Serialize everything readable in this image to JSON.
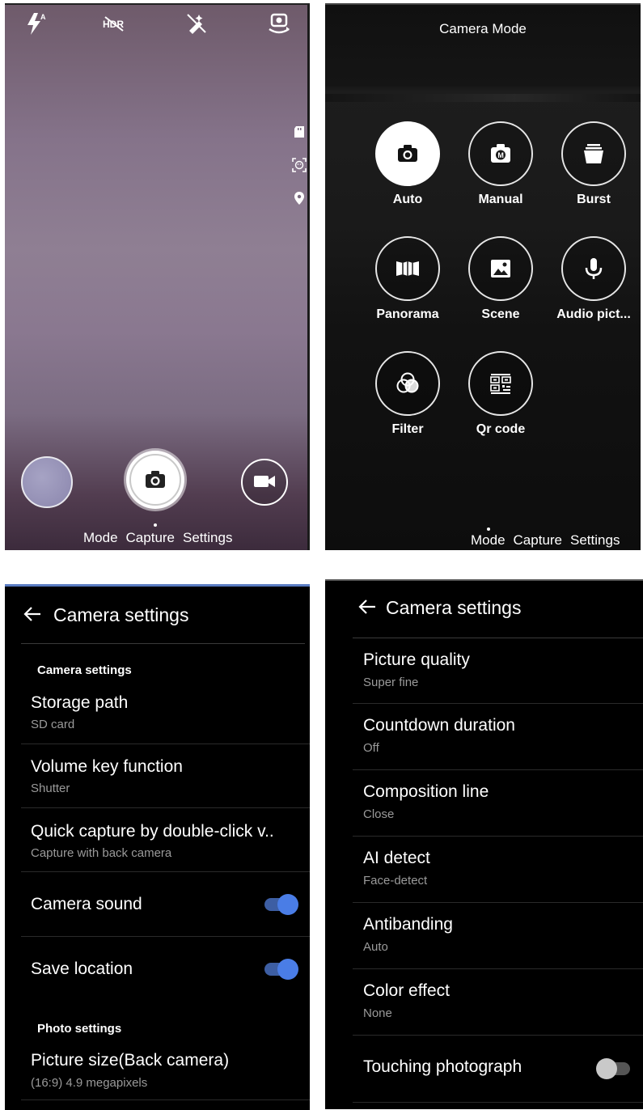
{
  "viewfinder": {
    "top_icons": [
      "flash-auto-icon",
      "hdr-off-icon",
      "beauty-off-icon",
      "switch-camera-icon"
    ],
    "side_icons": [
      "sd-card-icon",
      "face-detect-icon",
      "location-pin-icon"
    ],
    "bottom_nav": {
      "mode": "Mode",
      "capture": "Capture",
      "settings": "Settings"
    }
  },
  "camera_mode": {
    "title": "Camera Mode",
    "modes": [
      {
        "label": "Auto",
        "icon": "camera-icon",
        "active": true
      },
      {
        "label": "Manual",
        "icon": "manual-camera-icon",
        "active": false
      },
      {
        "label": "Burst",
        "icon": "burst-icon",
        "active": false
      },
      {
        "label": "Panorama",
        "icon": "panorama-icon",
        "active": false
      },
      {
        "label": "Scene",
        "icon": "scene-icon",
        "active": false
      },
      {
        "label": "Audio pict...",
        "icon": "microphone-icon",
        "active": false
      },
      {
        "label": "Filter",
        "icon": "filter-icon",
        "active": false
      },
      {
        "label": "Qr code",
        "icon": "qr-code-icon",
        "active": false
      }
    ],
    "bottom_nav": {
      "mode": "Mode",
      "capture": "Capture",
      "settings": "Settings"
    }
  },
  "settings_left": {
    "header": "Camera settings",
    "section_camera": "Camera settings",
    "section_photo": "Photo settings",
    "items": [
      {
        "title": "Storage path",
        "subtitle": "SD card"
      },
      {
        "title": "Volume key function",
        "subtitle": "Shutter"
      },
      {
        "title": "Quick capture by double-click v..",
        "subtitle": "Capture with back camera"
      },
      {
        "title": "Camera sound",
        "toggle": true
      },
      {
        "title": "Save location",
        "toggle": true
      },
      {
        "title": "Picture size(Back camera)",
        "subtitle": "(16:9) 4.9 megapixels"
      }
    ]
  },
  "settings_right": {
    "header": "Camera settings",
    "items": [
      {
        "title": "Picture quality",
        "subtitle": "Super fine"
      },
      {
        "title": "Countdown duration",
        "subtitle": "Off"
      },
      {
        "title": "Composition line",
        "subtitle": "Close"
      },
      {
        "title": "AI detect",
        "subtitle": "Face-detect"
      },
      {
        "title": "Antibanding",
        "subtitle": "Auto"
      },
      {
        "title": "Color effect",
        "subtitle": "None"
      },
      {
        "title": "Touching photograph",
        "toggle": false
      }
    ]
  },
  "colors": {
    "toggle_on": "#4a7de6",
    "toggle_off": "#c9c9c9",
    "settings_bg": "#000000"
  }
}
